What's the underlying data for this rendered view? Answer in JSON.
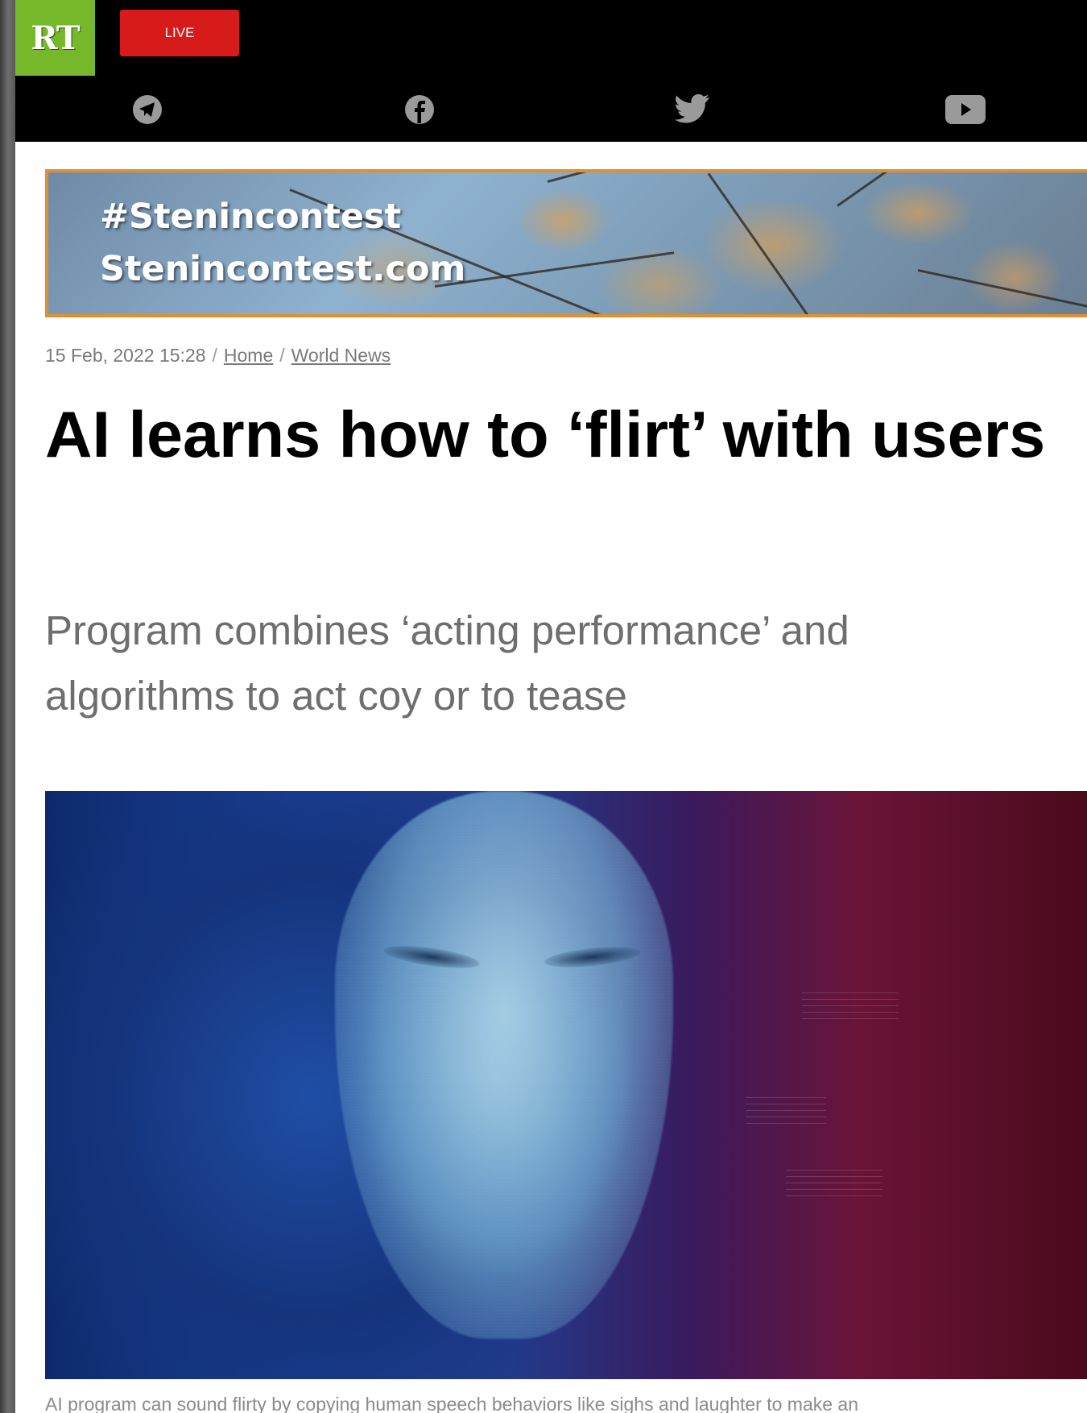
{
  "header": {
    "logo_text": "RT",
    "live_label": "LIVE",
    "social": [
      {
        "name": "telegram-icon"
      },
      {
        "name": "facebook-icon"
      },
      {
        "name": "twitter-icon"
      },
      {
        "name": "youtube-icon"
      }
    ]
  },
  "banner": {
    "line1": "#Stenincontest",
    "line2": "Stenincontest.com"
  },
  "article": {
    "date": "15 Feb, 2022 15:28",
    "breadcrumb": [
      "Home",
      "World News"
    ],
    "headline": "AI learns how to ‘flirt’ with users",
    "subheadline": "Program combines ‘acting performance’ and algorithms to act coy or to tease",
    "caption": "AI program can sound flirty by copying human speech behaviors like sighs and laughter to make an"
  },
  "colors": {
    "logo_green": "#77b82a",
    "live_red": "#d71a1a",
    "banner_border": "#e0902f"
  }
}
